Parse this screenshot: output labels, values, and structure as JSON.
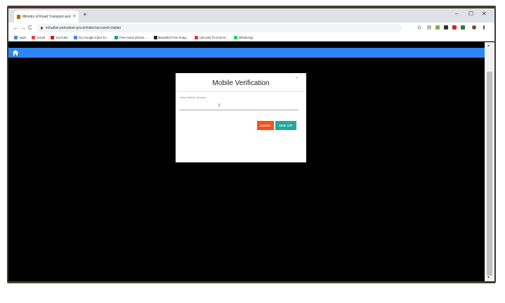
{
  "browser": {
    "tab_title": "Ministry of Road Transport and H",
    "new_tab": "+",
    "tab_close": "×",
    "url": "echallan.parivahan.gov.in/index/accused-challan",
    "window_controls": {
      "minimize": "–",
      "maximize": "☐",
      "close": "✕"
    },
    "nav": {
      "back": "←",
      "forward": "→",
      "reload": "C"
    }
  },
  "bookmarks": [
    {
      "label": "Apps",
      "color": "#4285f4"
    },
    {
      "label": "Gmail",
      "color": "#ea4335"
    },
    {
      "label": "YouTube",
      "color": "#ff0000"
    },
    {
      "label": "Try Google Input To...",
      "color": "#4285f4"
    },
    {
      "label": "Free stock photos ...",
      "color": "#05a081"
    },
    {
      "label": "Beautiful Free Imag...",
      "color": "#222222"
    },
    {
      "label": "Unicode To Kruti D...",
      "color": "#e53935"
    },
    {
      "label": "WhatsApp",
      "color": "#25d366"
    }
  ],
  "modal": {
    "title": "Mobile Verification",
    "close": "×",
    "mobile_label": "Enter Mobile Number",
    "mobile_value": "",
    "cursor": "I",
    "cancel_label": "CANCEL",
    "send_otp_label": "SEND OTP"
  },
  "colors": {
    "navbar": "#2d86f5",
    "cancel": "#f4511e",
    "send_otp": "#26a69a"
  },
  "icons": [
    "home-icon",
    "lock-icon",
    "star-icon",
    "profile-icon",
    "menu-icon"
  ]
}
